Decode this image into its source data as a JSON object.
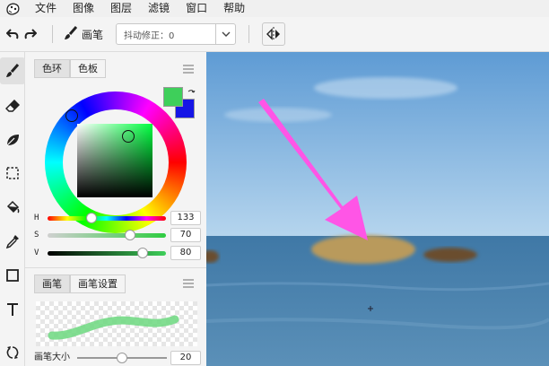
{
  "menu": [
    "文件",
    "图像",
    "图层",
    "滤镜",
    "窗口",
    "帮助"
  ],
  "toolbar": {
    "tool_name": "画笔",
    "smoothing_label": "抖动修正：0"
  },
  "color_panel": {
    "tabs": [
      "色环",
      "色板"
    ],
    "primary_color": "#3ecf5a",
    "secondary_color": "#1515e6",
    "sliders": [
      {
        "label": "H",
        "value": "133",
        "fraction": 0.37
      },
      {
        "label": "S",
        "value": "70",
        "fraction": 0.7
      },
      {
        "label": "V",
        "value": "80",
        "fraction": 0.8
      }
    ]
  },
  "brush_panel": {
    "tabs": [
      "画笔",
      "画笔设置"
    ],
    "size_label": "画笔大小",
    "size_value": "20",
    "size_fraction": 0.5
  },
  "tools": [
    "brush-icon",
    "eraser-icon",
    "leaf-icon",
    "marquee-icon",
    "bucket-icon",
    "eyedropper-icon",
    "rect-icon",
    "text-icon",
    "transform-icon"
  ],
  "canvas": {
    "arrow_color": "#ff55e6",
    "sea_color": "#4a7fa8",
    "sky_color": "#6fa7d8"
  }
}
